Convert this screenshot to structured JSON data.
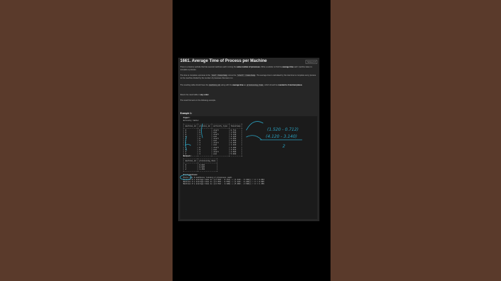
{
  "problem": {
    "title": "1661. Average Time of Process per Machine",
    "solved_badge": "Solved ⊘",
    "p1a": "There is a factory website that has several machines each running the ",
    "p1b": "same number of processes",
    "p1c": ". Write a solution to find the ",
    "p1d": "average time",
    "p1e": " each machine takes to complete a process.",
    "p2a": "The time to complete a process is the ",
    "p2b": "'end' timestamp",
    "p2c": " minus the ",
    "p2d": "'start' timestamp",
    "p2e": ". The average time is calculated by the total time to complete every process on the machine divided by the number of processes that were run.",
    "p3a": "The resulting table should have the ",
    "p3b": "machine_id",
    "p3c": " along with the ",
    "p3d": "average time",
    "p3e": " as ",
    "p3f": "processing_time",
    "p3g": ", which should be ",
    "p3h": "rounded to 3 decimal places",
    "p3i": ".",
    "p4a": "Return the result table in ",
    "p4b": "any order",
    "p4c": ".",
    "p5": "The result format is in the following example."
  },
  "example": {
    "title": "Example 1:",
    "input_label": "Input:",
    "table_name": "Activity table:",
    "input_table": "+------------+------------+---------------+-----------+\n| machine_id | process_id | activity_type | timestamp |\n+------------+------------+---------------+-----------+\n| 0          | 0          | start         | 0.712     |\n| 0          | 0          | end           | 1.520     |\n| 0          | 1          | start         | 3.140     |\n| 0          | 1          | end           | 4.120     |\n| 1          | 0          | start         | 0.550     |\n| 1          | 0          | end           | 1.550     |\n| 1          | 1          | start         | 0.430     |\n| 1          | 1          | end           | 1.420     |\n| 2          | 0          | start         | 4.100     |\n| 2          | 0          | end           | 4.512     |\n| 2          | 1          | start         | 2.500     |\n| 2          | 1          | end           | 5.000     |\n+------------+------------+---------------+-----------+",
    "output_label": "Output:",
    "output_table": "+------------+-----------------+\n| machine_id | processing_time |\n+------------+-----------------+\n| 0          | 0.894           |\n| 1          | 0.995           |\n| 2          | 1.456           |\n+------------+-----------------+",
    "explanation_label": "Explanation:",
    "explanation": "There are 3 machines running 2 processes each.\nMachine 0's average time is ((1.520 - 0.712) + (4.120 - 3.140)) / 2 = 0.894\nMachine 1's average time is ((1.550 - 0.550) + (1.420 - 0.430)) / 2 = 0.995\nMachine 2's average time is ((4.512 - 4.100) + (5.000 - 2.500)) / 2 = 1.456"
  },
  "annotations": {
    "line1": "(1.520 - 0.712)",
    "line2": "(4.120 - 3.140)",
    "divisor": "2",
    "ink_color": "#2aa3c2"
  },
  "colors": {
    "background_side": "#5a3a2b",
    "panel": "#262626",
    "code_block": "#1b1b1b"
  }
}
